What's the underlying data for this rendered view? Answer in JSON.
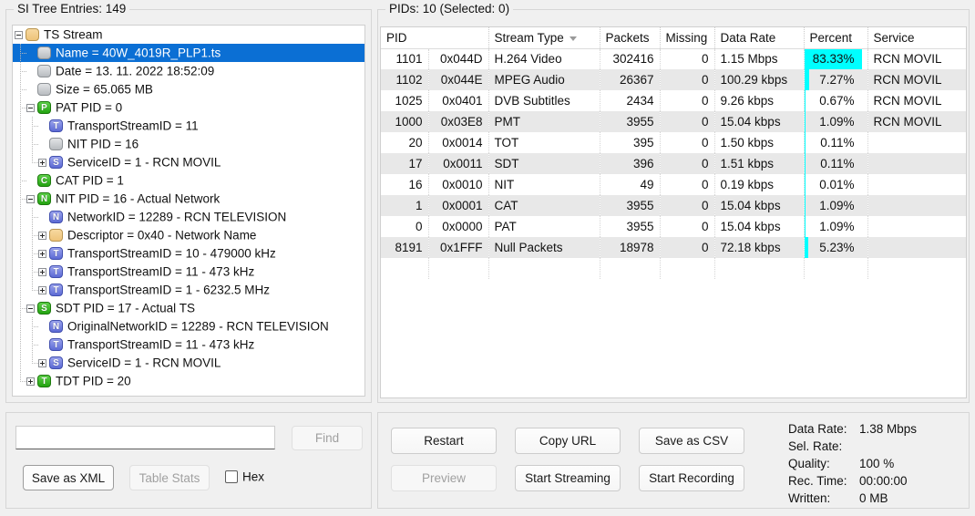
{
  "tree_panel": {
    "title": "SI Tree Entries: 149",
    "nodes": [
      {
        "depth": 0,
        "exp": "minus",
        "icon": "folder",
        "label": "TS Stream",
        "selected": false,
        "guide": "none"
      },
      {
        "depth": 1,
        "exp": "none",
        "icon": "grey",
        "label": "Name = 40W_4019R_PLP1.ts",
        "selected": true,
        "guide": "t"
      },
      {
        "depth": 1,
        "exp": "none",
        "icon": "grey",
        "label": "Date = 13. 11. 2022 18:52:09",
        "selected": false,
        "guide": "t"
      },
      {
        "depth": 1,
        "exp": "none",
        "icon": "grey",
        "label": "Size = 65.065 MB",
        "selected": false,
        "guide": "t"
      },
      {
        "depth": 1,
        "exp": "minus",
        "icon": "green",
        "glyph": "P",
        "label": "PAT PID = 0",
        "selected": false,
        "guide": "t"
      },
      {
        "depth": 2,
        "exp": "none",
        "icon": "purple",
        "glyph": "T",
        "label": "TransportStreamID = 11",
        "selected": false,
        "guide": "t"
      },
      {
        "depth": 2,
        "exp": "none",
        "icon": "grey",
        "label": "NIT PID = 16",
        "selected": false,
        "guide": "t"
      },
      {
        "depth": 2,
        "exp": "plus",
        "icon": "purple",
        "glyph": "S",
        "label": "ServiceID = 1 - RCN MOVIL",
        "selected": false,
        "guide": "l"
      },
      {
        "depth": 1,
        "exp": "none",
        "icon": "green",
        "glyph": "C",
        "label": "CAT PID = 1",
        "selected": false,
        "guide": "t"
      },
      {
        "depth": 1,
        "exp": "minus",
        "icon": "green",
        "glyph": "N",
        "label": "NIT PID = 16 - Actual Network",
        "selected": false,
        "guide": "t"
      },
      {
        "depth": 2,
        "exp": "none",
        "icon": "purple",
        "glyph": "N",
        "label": "NetworkID = 12289 - RCN TELEVISION",
        "selected": false,
        "guide": "t"
      },
      {
        "depth": 2,
        "exp": "plus",
        "icon": "folder",
        "label": "Descriptor = 0x40 - Network Name",
        "selected": false,
        "guide": "t"
      },
      {
        "depth": 2,
        "exp": "plus",
        "icon": "purple",
        "glyph": "T",
        "label": "TransportStreamID = 10 - 479000 kHz",
        "selected": false,
        "guide": "t"
      },
      {
        "depth": 2,
        "exp": "plus",
        "icon": "purple",
        "glyph": "T",
        "label": "TransportStreamID = 11 - 473 kHz",
        "selected": false,
        "guide": "t"
      },
      {
        "depth": 2,
        "exp": "plus",
        "icon": "purple",
        "glyph": "T",
        "label": "TransportStreamID = 1 - 6232.5 MHz",
        "selected": false,
        "guide": "l"
      },
      {
        "depth": 1,
        "exp": "minus",
        "icon": "green",
        "glyph": "S",
        "label": "SDT PID = 17 - Actual TS",
        "selected": false,
        "guide": "t"
      },
      {
        "depth": 2,
        "exp": "none",
        "icon": "purple",
        "glyph": "N",
        "label": "OriginalNetworkID = 12289 - RCN TELEVISION",
        "selected": false,
        "guide": "t"
      },
      {
        "depth": 2,
        "exp": "none",
        "icon": "purple",
        "glyph": "T",
        "label": "TransportStreamID = 11 - 473 kHz",
        "selected": false,
        "guide": "t"
      },
      {
        "depth": 2,
        "exp": "plus",
        "icon": "purple",
        "glyph": "S",
        "label": "ServiceID = 1 - RCN MOVIL",
        "selected": false,
        "guide": "l"
      },
      {
        "depth": 1,
        "exp": "plus",
        "icon": "green",
        "glyph": "T",
        "label": "TDT PID = 20",
        "selected": false,
        "guide": "l"
      }
    ]
  },
  "left_tools": {
    "find_value": "",
    "find_placeholder": "",
    "find_label": "Find",
    "save_xml_label": "Save as XML",
    "table_stats_label": "Table Stats",
    "hex_label": "Hex",
    "hex_checked": false
  },
  "pid_panel": {
    "title": "PIDs: 10   (Selected: 0)",
    "columns": [
      "PID",
      "Stream Type",
      "Packets",
      "Missing",
      "Data Rate",
      "Percent",
      "Service"
    ],
    "sorted_column": "Stream Type",
    "bar_color": "#00ffff",
    "rows": [
      {
        "pid": "1101",
        "hex": "0x044D",
        "type": "H.264 Video",
        "packets": "302416",
        "missing": "0",
        "rate": "1.15 Mbps",
        "percent": "83.33%",
        "percent_value": 83.33,
        "service": "RCN MOVIL"
      },
      {
        "pid": "1102",
        "hex": "0x044E",
        "type": "MPEG Audio",
        "packets": "26367",
        "missing": "0",
        "rate": "100.29 kbps",
        "percent": "7.27%",
        "percent_value": 7.27,
        "service": "RCN MOVIL"
      },
      {
        "pid": "1025",
        "hex": "0x0401",
        "type": "DVB Subtitles",
        "packets": "2434",
        "missing": "0",
        "rate": "9.26 kbps",
        "percent": "0.67%",
        "percent_value": 0.67,
        "service": "RCN MOVIL"
      },
      {
        "pid": "1000",
        "hex": "0x03E8",
        "type": "PMT",
        "packets": "3955",
        "missing": "0",
        "rate": "15.04 kbps",
        "percent": "1.09%",
        "percent_value": 1.09,
        "service": "RCN MOVIL"
      },
      {
        "pid": "20",
        "hex": "0x0014",
        "type": "TOT",
        "packets": "395",
        "missing": "0",
        "rate": "1.50 kbps",
        "percent": "0.11%",
        "percent_value": 0.11,
        "service": ""
      },
      {
        "pid": "17",
        "hex": "0x0011",
        "type": "SDT",
        "packets": "396",
        "missing": "0",
        "rate": "1.51 kbps",
        "percent": "0.11%",
        "percent_value": 0.11,
        "service": ""
      },
      {
        "pid": "16",
        "hex": "0x0010",
        "type": "NIT",
        "packets": "49",
        "missing": "0",
        "rate": "0.19 kbps",
        "percent": "0.01%",
        "percent_value": 0.01,
        "service": ""
      },
      {
        "pid": "1",
        "hex": "0x0001",
        "type": "CAT",
        "packets": "3955",
        "missing": "0",
        "rate": "15.04 kbps",
        "percent": "1.09%",
        "percent_value": 1.09,
        "service": ""
      },
      {
        "pid": "0",
        "hex": "0x0000",
        "type": "PAT",
        "packets": "3955",
        "missing": "0",
        "rate": "15.04 kbps",
        "percent": "1.09%",
        "percent_value": 1.09,
        "service": ""
      },
      {
        "pid": "8191",
        "hex": "0x1FFF",
        "type": "Null Packets",
        "packets": "18978",
        "missing": "0",
        "rate": "72.18 kbps",
        "percent": "5.23%",
        "percent_value": 5.23,
        "service": ""
      }
    ]
  },
  "right_tools": {
    "restart_label": "Restart",
    "copy_url_label": "Copy URL",
    "save_csv_label": "Save as CSV",
    "preview_label": "Preview",
    "start_streaming_label": "Start Streaming",
    "start_recording_label": "Start Recording",
    "stats": [
      {
        "label": "Data Rate:",
        "value": "1.38 Mbps"
      },
      {
        "label": "Sel. Rate:",
        "value": ""
      },
      {
        "label": "Quality:",
        "value": "100 %"
      },
      {
        "label": "Rec. Time:",
        "value": "00:00:00"
      },
      {
        "label": "Written:",
        "value": "0 MB"
      }
    ]
  }
}
